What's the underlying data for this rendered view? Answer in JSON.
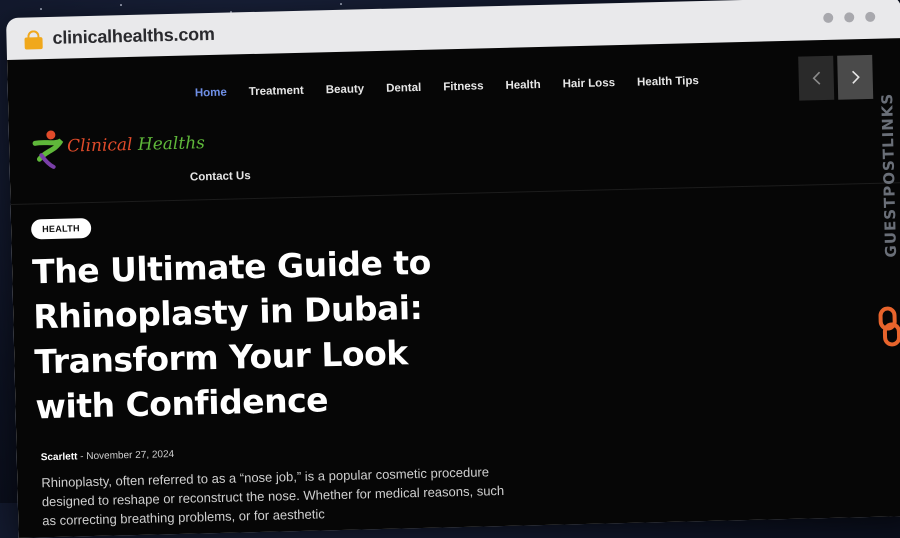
{
  "browser": {
    "url": "clinicalhealths.com"
  },
  "site": {
    "logo_text_part1": "Clinical",
    "logo_text_part2": " Healths"
  },
  "nav": {
    "items": [
      {
        "label": "Home",
        "active": true
      },
      {
        "label": "Treatment"
      },
      {
        "label": "Beauty"
      },
      {
        "label": "Dental"
      },
      {
        "label": "Fitness"
      },
      {
        "label": "Health"
      },
      {
        "label": "Hair Loss"
      },
      {
        "label": "Health Tips"
      }
    ],
    "second_row": "Contact Us"
  },
  "slider": {
    "prev_icon": "chevron-left-icon",
    "next_icon": "chevron-right-icon"
  },
  "article": {
    "category": "HEALTH",
    "title": "The Ultimate Guide to Rhinoplasty in Dubai: Transform Your Look with Confidence",
    "author": "Scarlett",
    "separator": "-",
    "date": "November 27, 2024",
    "excerpt": "Rhinoplasty, often referred to as a “nose job,” is a popular cosmetic procedure designed to reshape or reconstruct the nose. Whether for medical reasons, such as correcting breathing problems, or for aesthetic"
  },
  "watermark": {
    "text": "GUESTPOSTLINKS"
  },
  "colors": {
    "nav_active": "#6f8fe6",
    "lock": "#f0a81c",
    "logo_red": "#e04b2a",
    "logo_green": "#5fb83a",
    "watermark_chain": "#e8642c"
  }
}
